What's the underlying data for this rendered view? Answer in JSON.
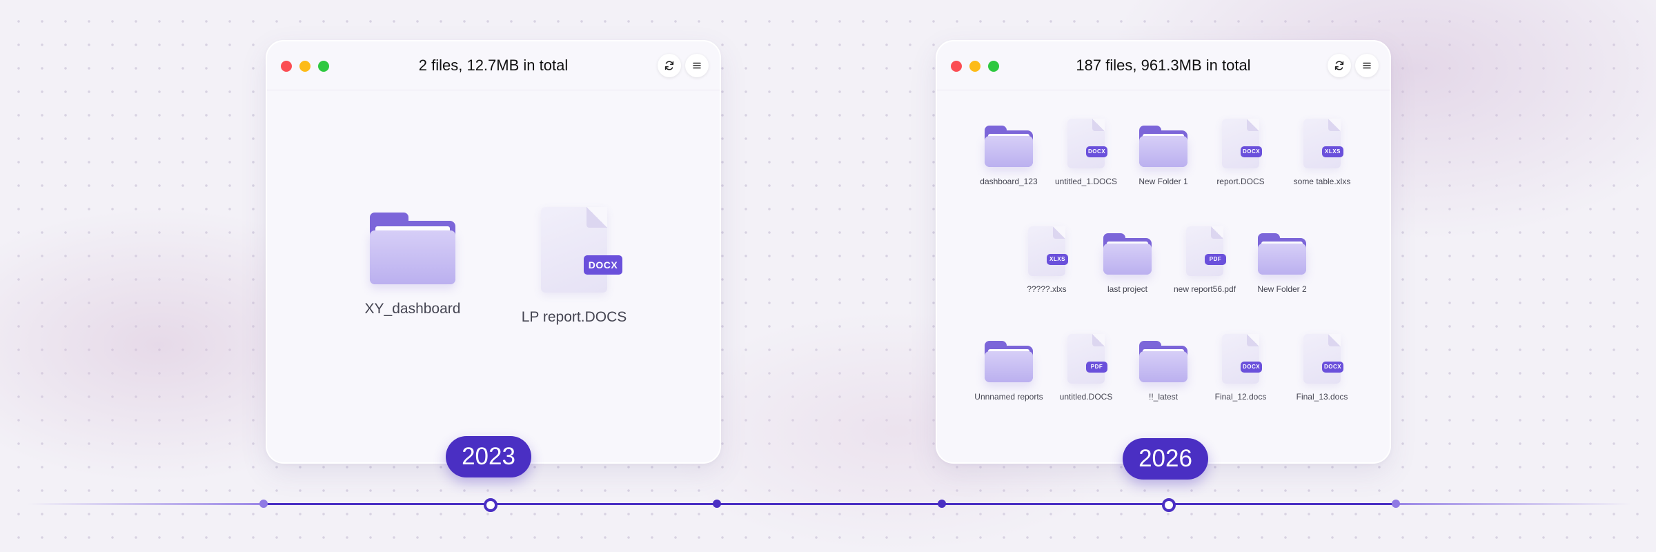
{
  "left_window": {
    "title": "2 files, 12.7MB in total",
    "files": [
      {
        "name": "XY_dashboard",
        "kind": "folder"
      },
      {
        "name": "LP report.DOCS",
        "kind": "doc",
        "badge": "DOCX"
      }
    ]
  },
  "right_window": {
    "title": "187 files, 961.3MB in total",
    "rows": [
      [
        {
          "name": "dashboard_123",
          "kind": "folder"
        },
        {
          "name": "untitled_1.DOCS",
          "kind": "doc",
          "badge": "DOCX"
        },
        {
          "name": "New Folder 1",
          "kind": "folder"
        },
        {
          "name": "report.DOCS",
          "kind": "doc",
          "badge": "DOCX"
        },
        {
          "name": "some table.xlxs",
          "kind": "doc",
          "badge": "XLXS"
        }
      ],
      [
        {
          "name": "?????.xlxs",
          "kind": "doc",
          "badge": "XLXS"
        },
        {
          "name": "last project",
          "kind": "folder"
        },
        {
          "name": "new report56.pdf",
          "kind": "doc",
          "badge": "PDF"
        },
        {
          "name": "New Folder 2",
          "kind": "folder"
        }
      ],
      [
        {
          "name": "Unnnamed reports",
          "kind": "folder"
        },
        {
          "name": "untitled.DOCS",
          "kind": "doc",
          "badge": "PDF"
        },
        {
          "name": "!!_latest",
          "kind": "folder"
        },
        {
          "name": "Final_12.docs",
          "kind": "doc",
          "badge": "DOCX"
        },
        {
          "name": "Final_13.docs",
          "kind": "doc",
          "badge": "DOCX"
        }
      ]
    ]
  },
  "timeline": {
    "years": [
      "2023",
      "2026"
    ]
  },
  "icons": {
    "refresh": "refresh-icon",
    "menu": "hamburger-menu-icon",
    "folder": "folder-icon",
    "document": "document-icon"
  },
  "colors": {
    "accent": "#4a2fc3",
    "folder": "#7c66d9",
    "traffic_red": "#fb4d53",
    "traffic_yellow": "#fdbb17",
    "traffic_green": "#2ec840"
  }
}
